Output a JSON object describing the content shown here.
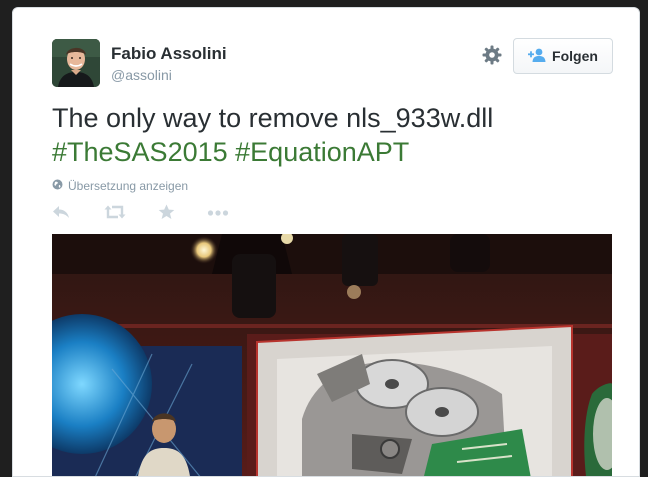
{
  "tweet": {
    "author_name": "Fabio Assolini",
    "author_handle": "@assolini",
    "text_main": "The only way to remove nls_933w.dll",
    "hashtags": [
      "#TheSAS2015",
      "#EquationAPT"
    ],
    "translate_label": "Übersetzung anzeigen",
    "follow_label": "Folgen"
  },
  "icons": {
    "avatar": "profile-photo",
    "settings": "gear-icon",
    "follow": "add-user-icon",
    "translate": "globe-icon",
    "reply": "reply-icon",
    "retweet": "retweet-icon",
    "favorite": "star-icon",
    "more": "more-icon"
  },
  "colors": {
    "hashtag": "#3b7a35",
    "follow_icon": "#55acee",
    "action_icon": "#ccd6dd",
    "muted_text": "#8899a6"
  }
}
